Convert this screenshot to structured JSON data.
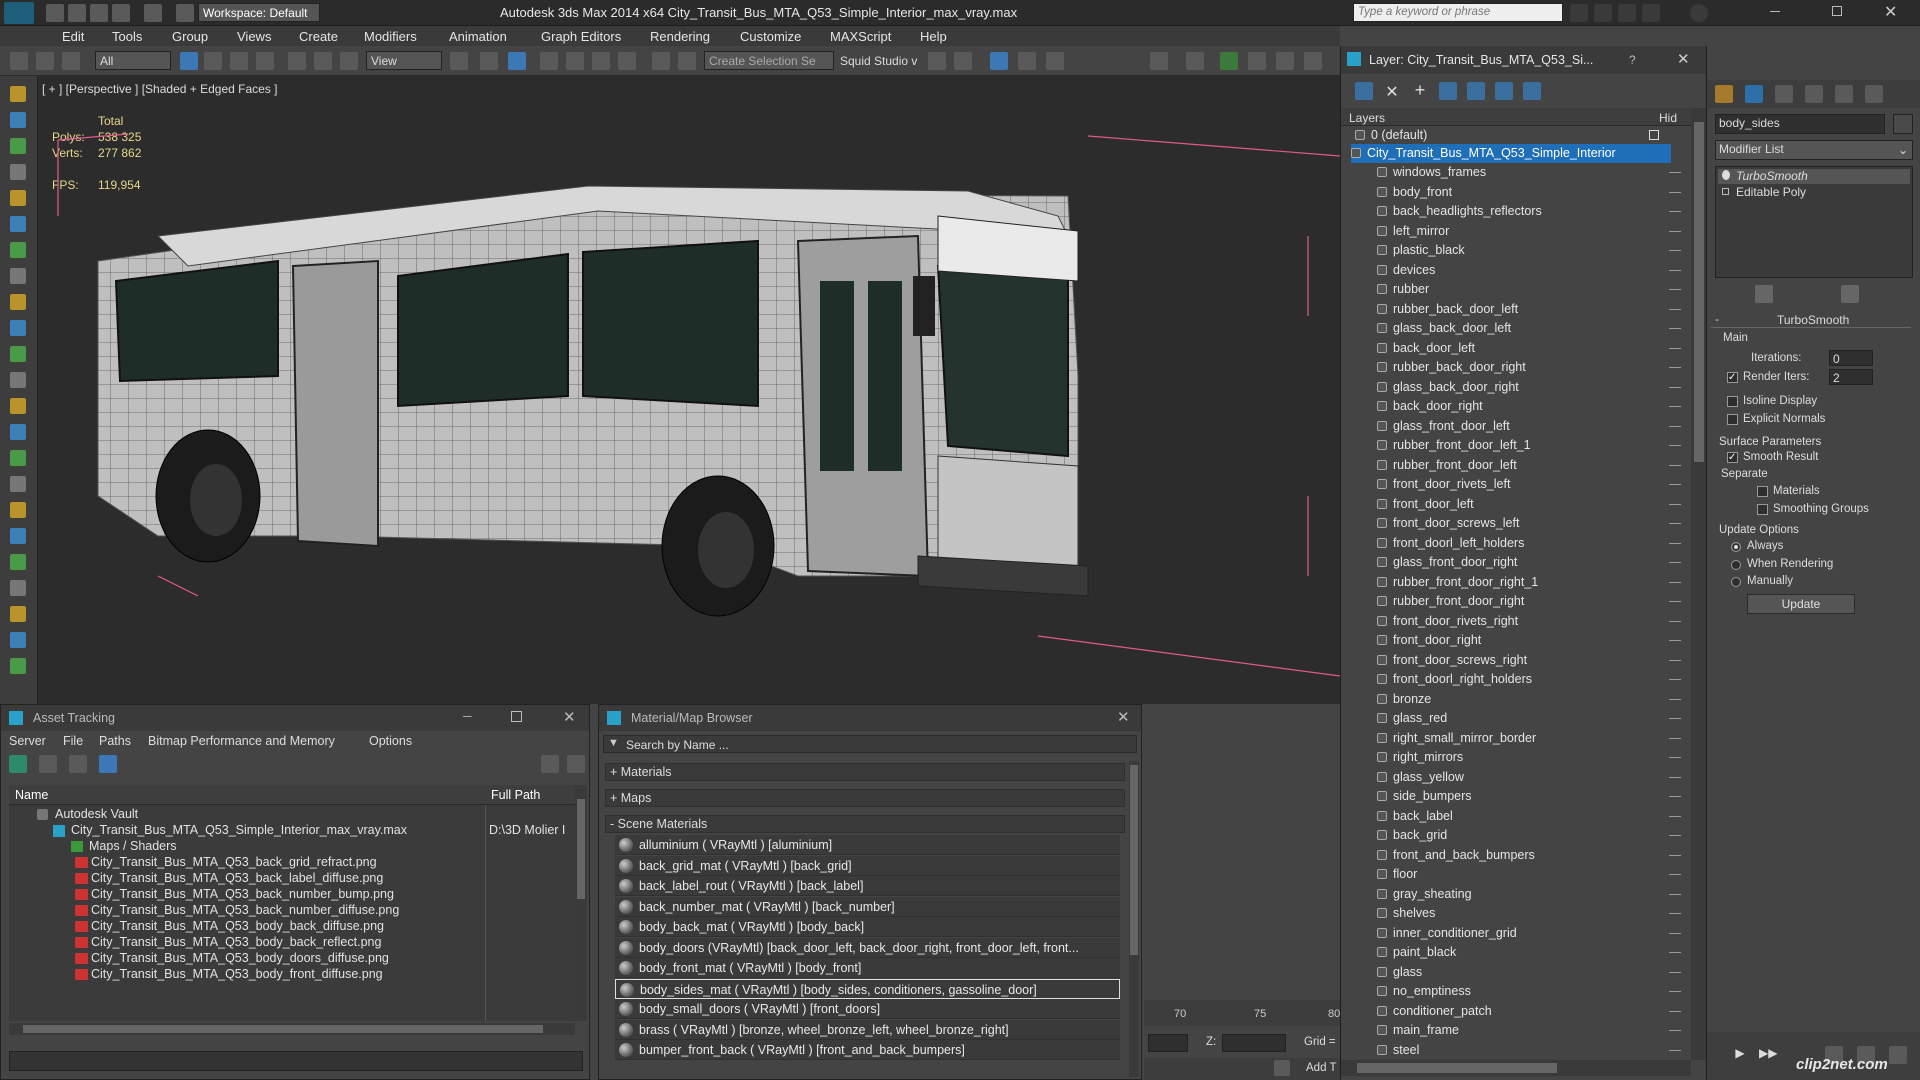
{
  "app": {
    "title": "Autodesk 3ds Max  2014 x64     City_Transit_Bus_MTA_Q53_Simple_Interior_max_vray.max",
    "workspace": "Workspace: Default",
    "search_placeholder": "Type a keyword or phrase"
  },
  "menu": [
    "Edit",
    "Tools",
    "Group",
    "Views",
    "Create",
    "Modifiers",
    "Animation",
    "Graph Editors",
    "Rendering",
    "Customize",
    "MAXScript",
    "Help"
  ],
  "toolbar": {
    "filter": "All",
    "ref_coord": "View",
    "selection_set": "Create Selection Se",
    "squid": "Squid Studio v"
  },
  "viewport": {
    "label": "[ + ] [Perspective ] [Shaded + Edged Faces ]",
    "stats": {
      "total_label": "Total",
      "polys_label": "Polys:",
      "polys": "538 325",
      "verts_label": "Verts:",
      "verts": "277 862",
      "fps_label": "FPS:",
      "fps": "119,954"
    }
  },
  "layer_panel": {
    "title": "Layer: City_Transit_Bus_MTA_Q53_Si...",
    "help": "?",
    "col_layers": "Layers",
    "col_hide": "Hid",
    "default_layer": "0 (default)",
    "selected_layer": "City_Transit_Bus_MTA_Q53_Simple_Interior",
    "items": [
      "windows_frames",
      "body_front",
      "back_headlights_reflectors",
      "left_mirror",
      "plastic_black",
      "devices",
      "rubber",
      "rubber_back_door_left",
      "glass_back_door_left",
      "back_door_left",
      "rubber_back_door_right",
      "glass_back_door_right",
      "back_door_right",
      "glass_front_door_left",
      "rubber_front_door_left_1",
      "rubber_front_door_left",
      "front_door_rivets_left",
      "front_door_left",
      "front_door_screws_left",
      "front_doorl_left_holders",
      "glass_front_door_right",
      "rubber_front_door_right_1",
      "rubber_front_door_right",
      "front_door_rivets_right",
      "front_door_right",
      "front_door_screws_right",
      "front_doorl_right_holders",
      "bronze",
      "glass_red",
      "right_small_mirror_border",
      "right_mirrors",
      "glass_yellow",
      "side_bumpers",
      "back_label",
      "back_grid",
      "front_and_back_bumpers",
      "floor",
      "gray_sheating",
      "shelves",
      "inner_conditioner_grid",
      "paint_black",
      "glass",
      "no_emptiness",
      "conditioner_patch",
      "main_frame",
      "steel"
    ]
  },
  "command_panel": {
    "object_name": "body_sides",
    "modifier_list": "Modifier List",
    "stack": [
      "TurboSmooth",
      "Editable Poly"
    ],
    "rollout_title": "TurboSmooth",
    "main_label": "Main",
    "iterations_label": "Iterations:",
    "iterations": "0",
    "render_iters_label": "Render Iters:",
    "render_iters": "2",
    "isoline": "Isoline Display",
    "explicit_normals": "Explicit Normals",
    "surface_params": "Surface Parameters",
    "smooth_result": "Smooth Result",
    "separate": "Separate",
    "materials": "Materials",
    "smoothing_groups": "Smoothing Groups",
    "update_options": "Update Options",
    "always": "Always",
    "when_rendering": "When Rendering",
    "manually": "Manually",
    "update_btn": "Update"
  },
  "asset_tracking": {
    "title": "Asset Tracking",
    "menu": [
      "Server",
      "File",
      "Paths",
      "Bitmap Performance and Memory",
      "Options"
    ],
    "col_name": "Name",
    "col_path": "Full Path",
    "vault": "Autodesk Vault",
    "file": "City_Transit_Bus_MTA_Q53_Simple_Interior_max_vray.max",
    "file_path": "D:\\3D Molier I",
    "maps_folder": "Maps / Shaders",
    "maps": [
      "City_Transit_Bus_MTA_Q53_back_grid_refract.png",
      "City_Transit_Bus_MTA_Q53_back_label_diffuse.png",
      "City_Transit_Bus_MTA_Q53_back_number_bump.png",
      "City_Transit_Bus_MTA_Q53_back_number_diffuse.png",
      "City_Transit_Bus_MTA_Q53_body_back_diffuse.png",
      "City_Transit_Bus_MTA_Q53_body_back_reflect.png",
      "City_Transit_Bus_MTA_Q53_body_doors_diffuse.png",
      "City_Transit_Bus_MTA_Q53_body_front_diffuse.png"
    ]
  },
  "material_browser": {
    "title": "Material/Map Browser",
    "search": "Search by Name ...",
    "materials_group": "+ Materials",
    "maps_group": "+ Maps",
    "scene_group": "- Scene Materials",
    "items": [
      "alluminium  ( VRayMtl ) [aluminium]",
      "back_grid_mat  ( VRayMtl ) [back_grid]",
      "back_label_rout  ( VRayMtl ) [back_label]",
      "back_number_mat  ( VRayMtl ) [back_number]",
      "body_back_mat  ( VRayMtl ) [body_back]",
      "body_doors  (VRayMtl) [back_door_left, back_door_right, front_door_left, front...",
      "body_front_mat  ( VRayMtl ) [body_front]",
      "body_sides_mat  ( VRayMtl ) [body_sides, conditioners, gassoline_door]",
      "body_small_doors  ( VRayMtl ) [front_doors]",
      "brass  ( VRayMtl ) [bronze, wheel_bronze_left, wheel_bronze_right]",
      "bumper_front_back  ( VRayMtl ) [front_and_back_bumpers]"
    ]
  },
  "timeline": {
    "t70": "70",
    "t75": "75",
    "t80": "80",
    "z_label": "Z:",
    "grid_label": "Grid =",
    "add_t": "Add T"
  },
  "watermark": "clip2net.com",
  "colors": {
    "accent": "#1f6fb8",
    "stat": "#e8d78a",
    "pink": "#e05a8c"
  }
}
